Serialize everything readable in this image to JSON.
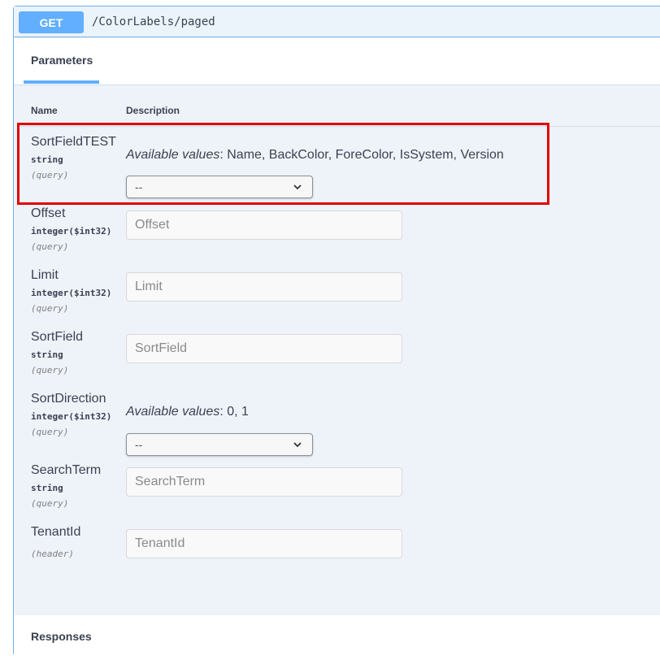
{
  "operation": {
    "method": "GET",
    "path": "/ColorLabels/paged"
  },
  "tabs": {
    "parameters_label": "Parameters"
  },
  "table": {
    "col_name": "Name",
    "col_description": "Description"
  },
  "params": [
    {
      "name": "SortFieldTEST",
      "type": "string",
      "in": "(query)",
      "available_label": "Available values",
      "available_values": ": Name, BackColor, ForeColor, IsSystem, Version",
      "select_value": "--"
    },
    {
      "name": "Offset",
      "type": "integer($int32)",
      "in": "(query)",
      "placeholder": "Offset"
    },
    {
      "name": "Limit",
      "type": "integer($int32)",
      "in": "(query)",
      "placeholder": "Limit"
    },
    {
      "name": "SortField",
      "type": "string",
      "in": "(query)",
      "placeholder": "SortField"
    },
    {
      "name": "SortDirection",
      "type": "integer($int32)",
      "in": "(query)",
      "available_label": "Available values",
      "available_values": ": 0, 1",
      "select_value": "--"
    },
    {
      "name": "SearchTerm",
      "type": "string",
      "in": "(query)",
      "placeholder": "SearchTerm"
    },
    {
      "name": "TenantId",
      "in": "(header)",
      "placeholder": "TenantId"
    }
  ],
  "responses": {
    "label": "Responses"
  },
  "colors": {
    "get_accent": "#61affe",
    "highlight": "#e00000",
    "block_background": "#eef3fa"
  }
}
